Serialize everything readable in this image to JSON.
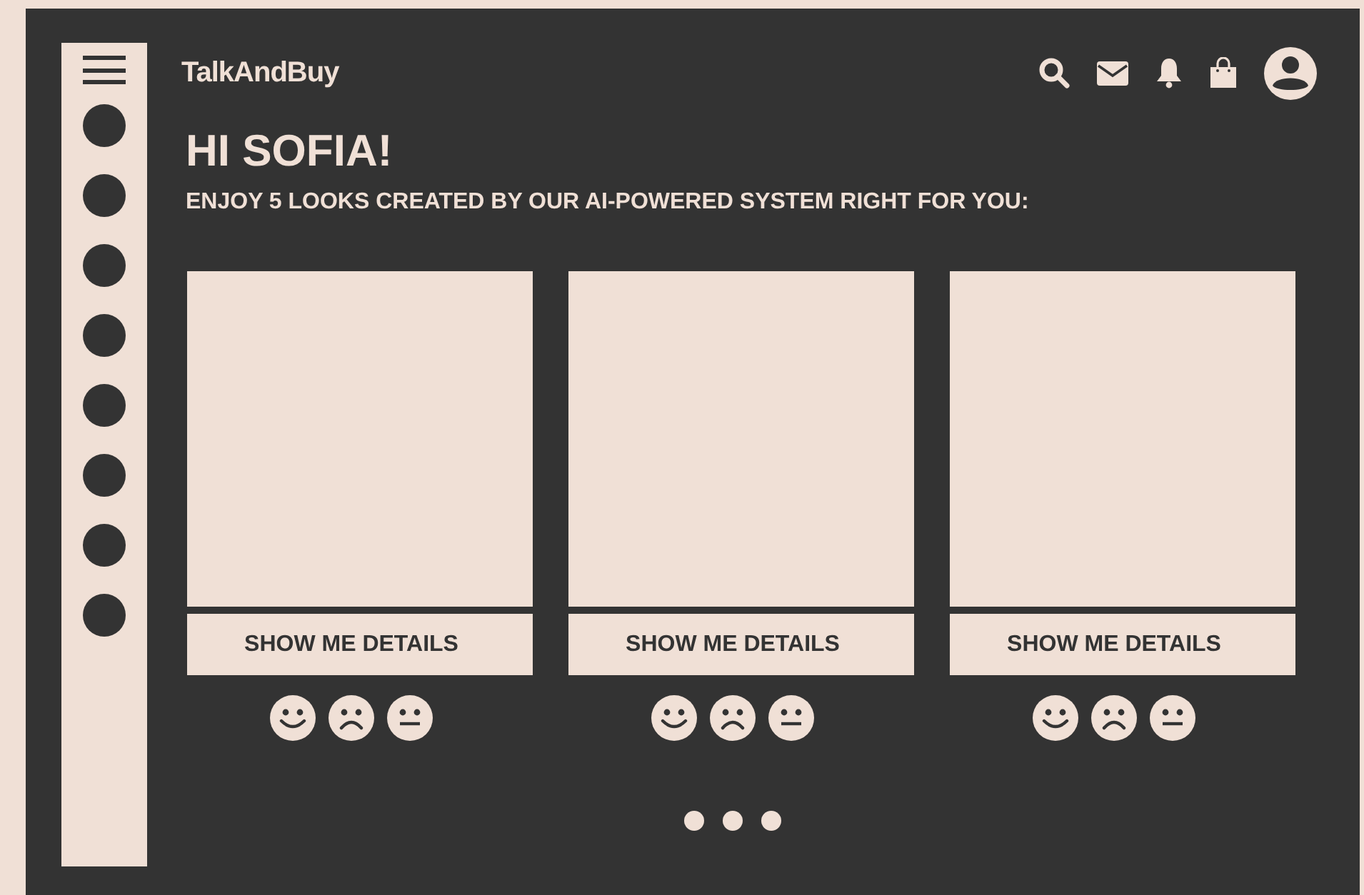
{
  "sidebar": {
    "items": [
      {
        "kind": "dot"
      },
      {
        "kind": "dot"
      },
      {
        "kind": "dot"
      },
      {
        "kind": "dot"
      },
      {
        "kind": "dot"
      },
      {
        "kind": "dot"
      },
      {
        "kind": "dot"
      },
      {
        "kind": "dot"
      }
    ]
  },
  "header": {
    "brand": "TalkAndBuy",
    "icons": [
      {
        "kind": "search"
      },
      {
        "kind": "mail"
      },
      {
        "kind": "bell"
      },
      {
        "kind": "bag"
      },
      {
        "kind": "avatar"
      }
    ]
  },
  "greeting": "HI SOFIA!",
  "subtitle": "ENJOY 5 LOOKS CREATED BY OUR AI-POWERED SYSTEM RIGHT FOR YOU:",
  "cards": [
    {
      "button": "SHOW ME DETAILS",
      "reactions": [
        {
          "kind": "happy"
        },
        {
          "kind": "sad"
        },
        {
          "kind": "neutral"
        }
      ]
    },
    {
      "button": "SHOW ME DETAILS",
      "reactions": [
        {
          "kind": "happy"
        },
        {
          "kind": "sad"
        },
        {
          "kind": "neutral"
        }
      ]
    },
    {
      "button": "SHOW ME DETAILS",
      "reactions": [
        {
          "kind": "happy"
        },
        {
          "kind": "sad"
        },
        {
          "kind": "neutral"
        }
      ]
    }
  ],
  "pagination": [
    {
      "kind": "dot"
    },
    {
      "kind": "dot"
    },
    {
      "kind": "dot"
    }
  ]
}
